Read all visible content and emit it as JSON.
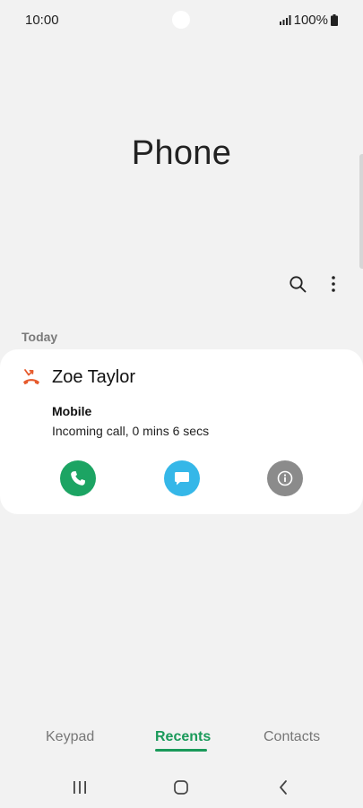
{
  "status_bar": {
    "time": "10:00",
    "battery": "100%"
  },
  "app": {
    "title": "Phone"
  },
  "recents": {
    "section_label": "Today",
    "entries": [
      {
        "contact_name": "Zoe Taylor",
        "number_type": "Mobile",
        "detail": "Incoming call, 0 mins 6 secs",
        "call_type_icon": "missed-call-icon"
      }
    ]
  },
  "tabs": {
    "keypad": "Keypad",
    "recents": "Recents",
    "contacts": "Contacts",
    "active": "recents"
  },
  "colors": {
    "accent": "#1a9a5a",
    "call_button": "#1ca463",
    "message_button": "#35b7e8",
    "info_button": "#8b8b8b",
    "missed_call": "#e65a2c"
  }
}
